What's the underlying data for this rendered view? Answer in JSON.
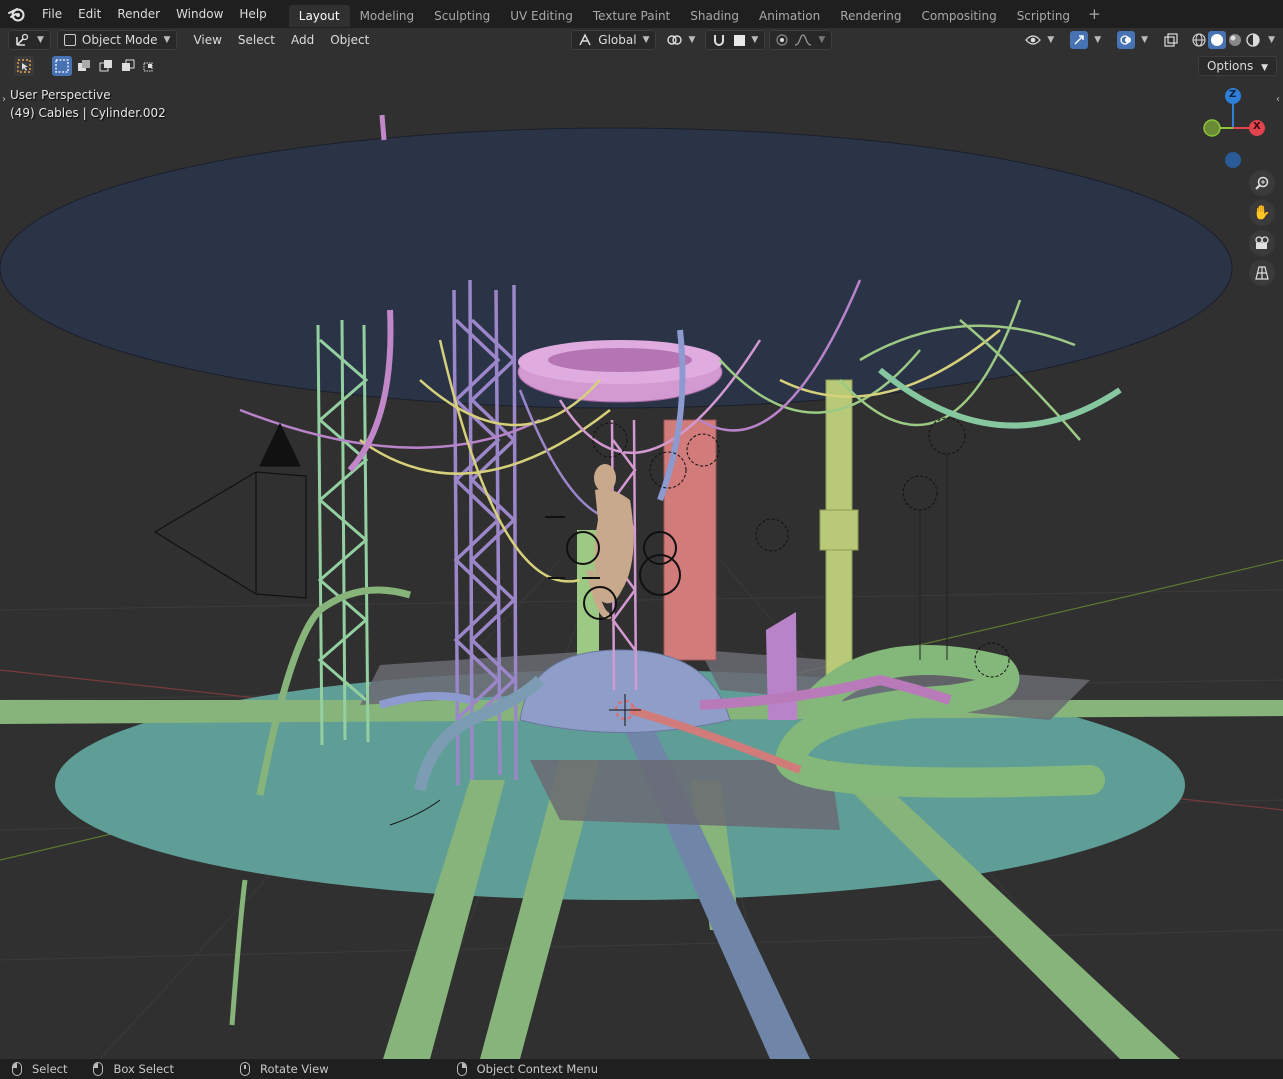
{
  "menu": [
    "File",
    "Edit",
    "Render",
    "Window",
    "Help"
  ],
  "workspaces": [
    "Layout",
    "Modeling",
    "Sculpting",
    "UV Editing",
    "Texture Paint",
    "Shading",
    "Animation",
    "Rendering",
    "Compositing",
    "Scripting"
  ],
  "active_workspace": "Layout",
  "header": {
    "mode": "Object Mode",
    "view": "View",
    "select": "Select",
    "add": "Add",
    "object": "Object",
    "orientation": "Global",
    "options": "Options"
  },
  "viewport": {
    "perspective": "User Perspective",
    "active_object": "(49) Cables | Cylinder.002"
  },
  "gizmo": {
    "z": "Z",
    "x": "X",
    "colors": {
      "x": "#e0424e",
      "y": "#8bc43a",
      "z": "#2f7ed8"
    }
  },
  "statusbar": {
    "select": "Select",
    "box_select": "Box Select",
    "rotate_view": "Rotate View",
    "context_menu": "Object Context Menu"
  },
  "colors": {
    "topbar": "#1f1f1f",
    "viewport_bg": "#303030",
    "accent": "#4772b3",
    "mint": "#86c7a0",
    "lavender": "#9b86c9",
    "salmon": "#d17b7b",
    "pink": "#d39ad1",
    "olive": "#b8c978",
    "navy_disc": "#2b3447",
    "teal_floor": "#5f9e97"
  }
}
